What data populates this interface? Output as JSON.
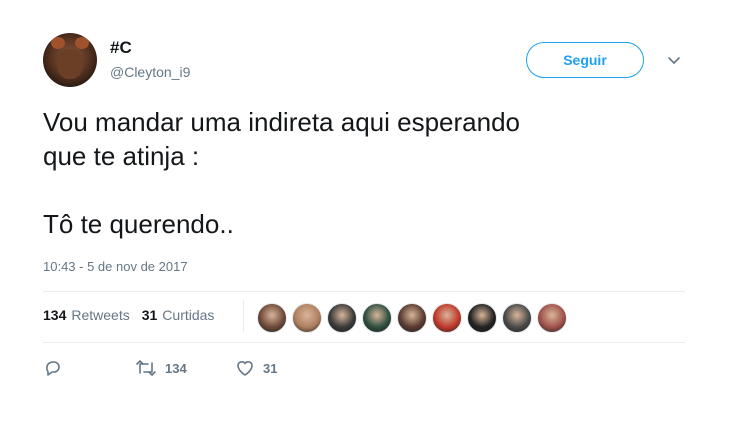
{
  "author": {
    "name": "#C",
    "handle": "@Cleyton_i9"
  },
  "follow_button": {
    "label": "Seguir"
  },
  "tweet": {
    "text": "Vou mandar uma indireta aqui esperando\nque te atinja :\n\nTô te querendo..",
    "timestamp": "10:43 - 5 de nov de 2017"
  },
  "stats": {
    "retweets_count": "134",
    "retweets_label": "Retweets",
    "likes_count": "31",
    "likes_label": "Curtidas"
  },
  "liker_avatars": [
    {
      "color": "#6e4a3a"
    },
    {
      "color": "#b08060"
    },
    {
      "color": "#3a3a3a"
    },
    {
      "color": "#2f4f3f"
    },
    {
      "color": "#5a3c30"
    },
    {
      "color": "#c0392b"
    },
    {
      "color": "#222222"
    },
    {
      "color": "#4a4a4a"
    },
    {
      "color": "#a0524a"
    }
  ],
  "actions": {
    "reply_icon": "reply-icon",
    "retweet_icon": "retweet-icon",
    "retweet_count": "134",
    "like_icon": "heart-icon",
    "like_count": "31"
  },
  "colors": {
    "accent": "#1da1f2",
    "secondary_text": "#657786",
    "divider": "#e6ecf0"
  }
}
